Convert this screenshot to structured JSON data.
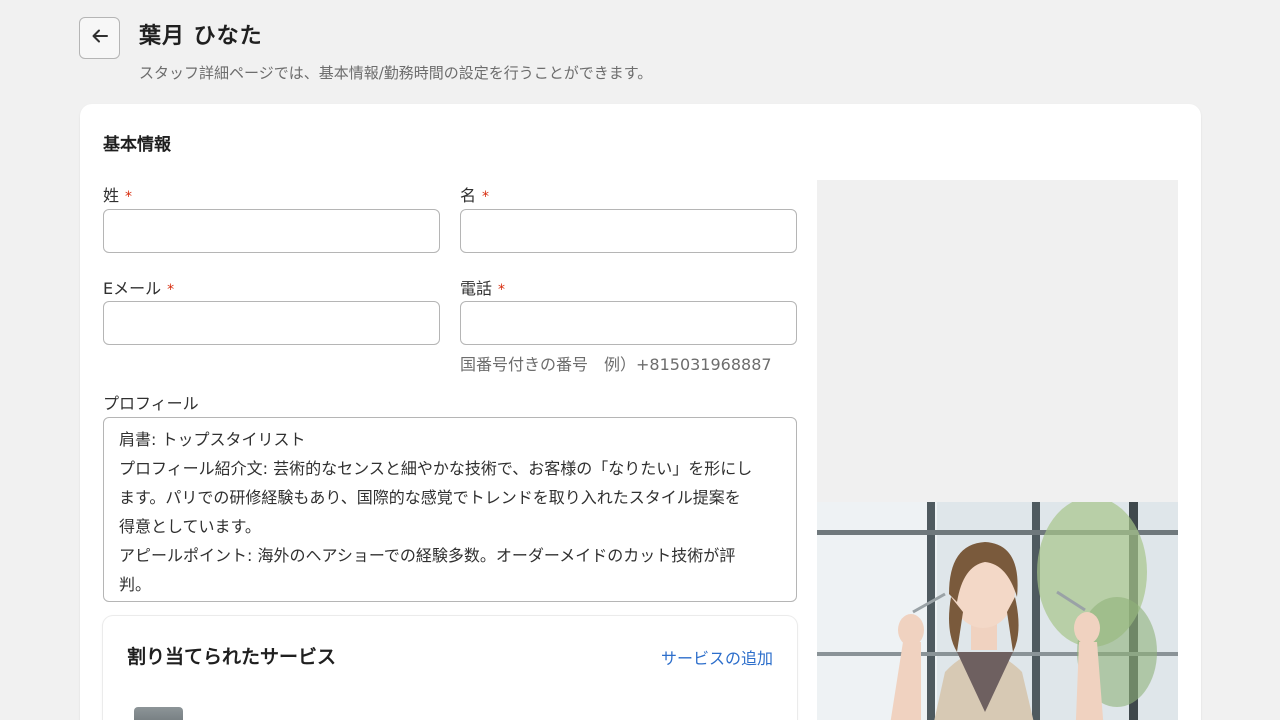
{
  "header": {
    "title": "葉月 ひなた",
    "subtitle": "スタッフ詳細ページでは、基本情報/勤務時間の設定を行うことができます。"
  },
  "basic_info": {
    "heading": "基本情報",
    "required_mark": "*",
    "last_name": {
      "label": "姓",
      "value": ""
    },
    "first_name": {
      "label": "名",
      "value": ""
    },
    "email": {
      "label": "Eメール",
      "value": ""
    },
    "phone": {
      "label": "電話",
      "value": "",
      "hint": "国番号付きの番号　例）+815031968887"
    },
    "profile": {
      "label": "プロフィール",
      "lines": [
        "肩書: トップスタイリスト",
        "プロフィール紹介文: 芸術的なセンスと細やかな技術で、お客様の「なりたい」を形にし",
        "ます。パリでの研修経験もあり、国際的な感覚でトレンドを取り入れたスタイル提案を",
        "得意としています。",
        "アピールポイント: 海外のヘアショーでの経験多数。オーダーメイドのカット技術が評",
        "判。"
      ]
    }
  },
  "services": {
    "title": "割り当てられたサービス",
    "add_label": "サービスの追加"
  },
  "colors": {
    "background": "#f1f1f1",
    "card": "#ffffff",
    "required": "#d72c0d",
    "link": "#2c6ecb"
  }
}
